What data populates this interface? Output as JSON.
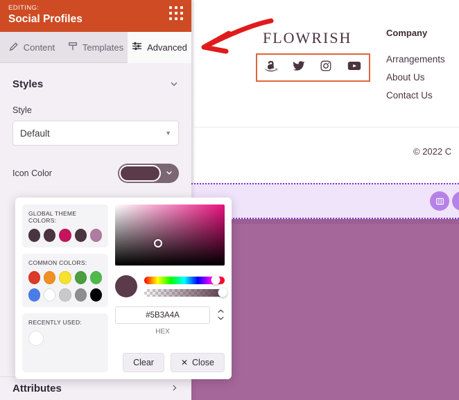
{
  "panel": {
    "header": {
      "editing_label": "EDITING:",
      "title": "Social Profiles",
      "grid_icon": "grid-dots-icon"
    },
    "tabs": [
      {
        "label": "Content",
        "icon": "pencil-icon",
        "active": false
      },
      {
        "label": "Templates",
        "icon": "template-icon",
        "active": false
      },
      {
        "label": "Advanced",
        "icon": "sliders-icon",
        "active": true
      }
    ],
    "styles_section": {
      "title": "Styles",
      "chevron": "chevron-down-icon"
    },
    "style_field": {
      "label": "Style",
      "value": "Default",
      "caret": "caret-down-icon"
    },
    "icon_color_field": {
      "label": "Icon Color",
      "value": "#5B3A4A",
      "caret": "chevron-down-icon"
    },
    "attributes_row": {
      "label": "Attributes",
      "chevron": "chevron-right-icon"
    }
  },
  "picker": {
    "global_theme": {
      "title": "GLOBAL THEME COLORS:",
      "swatches": [
        "#4a3440",
        "#4a3440",
        "#c4145e",
        "#4a3440",
        "#b07ba0"
      ]
    },
    "common": {
      "title": "COMMON COLORS:",
      "row1": [
        "#db3b28",
        "#f09023",
        "#f5e12e",
        "#4a9e3f",
        "#4fb949"
      ],
      "row2": [
        "#4a7de8",
        "#ffffff",
        "#c9c9c9",
        "#8e8e8e",
        "#000000"
      ]
    },
    "recent": {
      "title": "RECENTLY USED:",
      "swatches": [
        "#ffffff"
      ]
    },
    "hex": {
      "value": "#5B3A4A",
      "placeholder": "#000000",
      "label": "HEX"
    },
    "preview_color": "#5B3A4A",
    "buttons": {
      "clear": "Clear",
      "close": "Close",
      "close_icon": "close-x-icon"
    },
    "stepper": {
      "up": "⌃",
      "down": "⌄"
    }
  },
  "preview": {
    "logo": "FLOWRISH",
    "social_icons": [
      "amazon-icon",
      "twitter-icon",
      "instagram-icon",
      "youtube-icon"
    ],
    "column": {
      "title": "Company",
      "links": [
        "Arrangements",
        "About Us",
        "Contact Us"
      ]
    },
    "copyright": "© 2022 C",
    "toolbar_icons": [
      "columns-icon",
      "second-icon"
    ],
    "highlight_border_color": "#e0643c",
    "selection_border_color": "#7b35d6"
  }
}
